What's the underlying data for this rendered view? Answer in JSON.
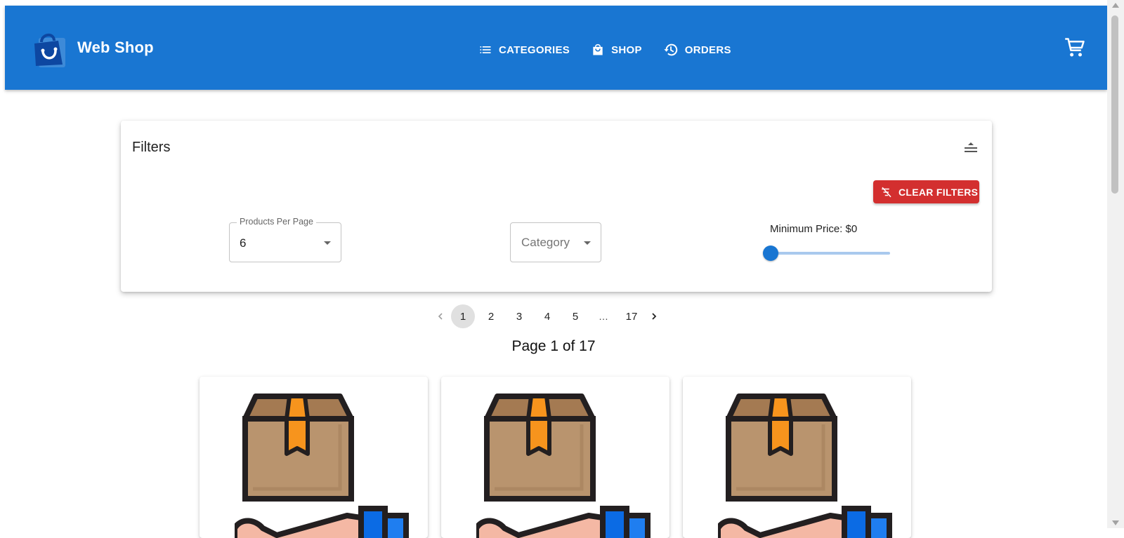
{
  "app": {
    "title": "Web Shop",
    "nav": [
      {
        "label": "CATEGORIES",
        "icon": "list-icon"
      },
      {
        "label": "SHOP",
        "icon": "shopping-bag-icon"
      },
      {
        "label": "ORDERS",
        "icon": "history-icon"
      }
    ],
    "cart_icon": "cart-icon"
  },
  "filters": {
    "title": "Filters",
    "clear_button": "CLEAR FILTERS",
    "products_per_page": {
      "label": "Products Per Page",
      "value": "6"
    },
    "category": {
      "placeholder": "Category"
    },
    "min_price": {
      "label": "Minimum Price: $0",
      "value": 0
    }
  },
  "pagination": {
    "pages": [
      "1",
      "2",
      "3",
      "4",
      "5"
    ],
    "ellipsis": "…",
    "last": "17",
    "current": "1",
    "status": "Page 1 of 17"
  },
  "products": [
    {
      "image": "package-delivery-icon"
    },
    {
      "image": "package-delivery-icon"
    },
    {
      "image": "package-delivery-icon"
    }
  ],
  "colors": {
    "brand": "#1976d2",
    "danger": "#d32f2f",
    "box": "#b9946e",
    "tape": "#f7941d",
    "outline": "#231f20"
  }
}
